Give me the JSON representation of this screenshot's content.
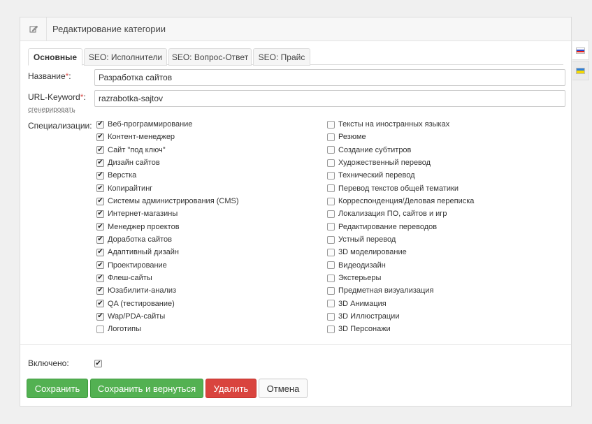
{
  "header": {
    "title": "Редактирование категории",
    "icon": "edit-icon"
  },
  "tabs": [
    {
      "label": "Основные",
      "active": true
    },
    {
      "label": "SEO: Исполнители",
      "active": false
    },
    {
      "label": "SEO: Вопрос-Ответ",
      "active": false
    },
    {
      "label": "SEO: Прайс",
      "active": false
    }
  ],
  "form": {
    "name_label": "Название",
    "name_value": "Разработка сайтов",
    "url_label": "URL-Keyword",
    "url_value": "razrabotka-sajtov",
    "required_mark": "*",
    "label_colon": ":",
    "generate_link": "сгенерировать",
    "specializations_label": "Специализации:",
    "enabled_label": "Включено:",
    "enabled_checked": true
  },
  "specializations_left": [
    {
      "label": "Веб-программирование",
      "checked": true
    },
    {
      "label": "Контент-менеджер",
      "checked": true
    },
    {
      "label": "Сайт \"под ключ\"",
      "checked": true
    },
    {
      "label": "Дизайн сайтов",
      "checked": true
    },
    {
      "label": "Верстка",
      "checked": true
    },
    {
      "label": "Копирайтинг",
      "checked": true
    },
    {
      "label": "Системы администрирования (CMS)",
      "checked": true
    },
    {
      "label": "Интернет-магазины",
      "checked": true
    },
    {
      "label": "Менеджер проектов",
      "checked": true
    },
    {
      "label": "Доработка сайтов",
      "checked": true
    },
    {
      "label": "Адаптивный дизайн",
      "checked": true
    },
    {
      "label": "Проектирование",
      "checked": true
    },
    {
      "label": "Флеш-сайты",
      "checked": true
    },
    {
      "label": "Юзабилити-анализ",
      "checked": true
    },
    {
      "label": "QA (тестирование)",
      "checked": true
    },
    {
      "label": "Wap/PDA-сайты",
      "checked": true
    },
    {
      "label": "Логотипы",
      "checked": false
    }
  ],
  "specializations_right": [
    {
      "label": "Тексты на иностранных языках",
      "checked": false
    },
    {
      "label": "Резюме",
      "checked": false
    },
    {
      "label": "Создание субтитров",
      "checked": false
    },
    {
      "label": "Художественный перевод",
      "checked": false
    },
    {
      "label": "Технический перевод",
      "checked": false
    },
    {
      "label": "Перевод текстов общей тематики",
      "checked": false
    },
    {
      "label": "Корреспонденция/Деловая переписка",
      "checked": false
    },
    {
      "label": "Локализация ПО, сайтов и игр",
      "checked": false
    },
    {
      "label": "Редактирование переводов",
      "checked": false
    },
    {
      "label": "Устный перевод",
      "checked": false
    },
    {
      "label": "3D моделирование",
      "checked": false
    },
    {
      "label": "Видеодизайн",
      "checked": false
    },
    {
      "label": "Экстерьеры",
      "checked": false
    },
    {
      "label": "Предметная визуализация",
      "checked": false
    },
    {
      "label": "3D Анимация",
      "checked": false
    },
    {
      "label": "3D Иллюстрации",
      "checked": false
    },
    {
      "label": "3D Персонажи",
      "checked": false
    }
  ],
  "buttons": {
    "save": "Сохранить",
    "save_return": "Сохранить и вернуться",
    "delete": "Удалить",
    "cancel": "Отмена"
  },
  "languages": [
    {
      "icon": "russian-flag-icon",
      "active": true,
      "colors": [
        "#ffffff",
        "#2e4bd1",
        "#e2231a"
      ]
    },
    {
      "icon": "ukrainian-flag-icon",
      "active": false,
      "colors": [
        "#2e7fd8",
        "#f5d800"
      ]
    }
  ],
  "colors": {
    "success": "#53b152",
    "danger": "#d9443e",
    "required": "#d9534f"
  }
}
